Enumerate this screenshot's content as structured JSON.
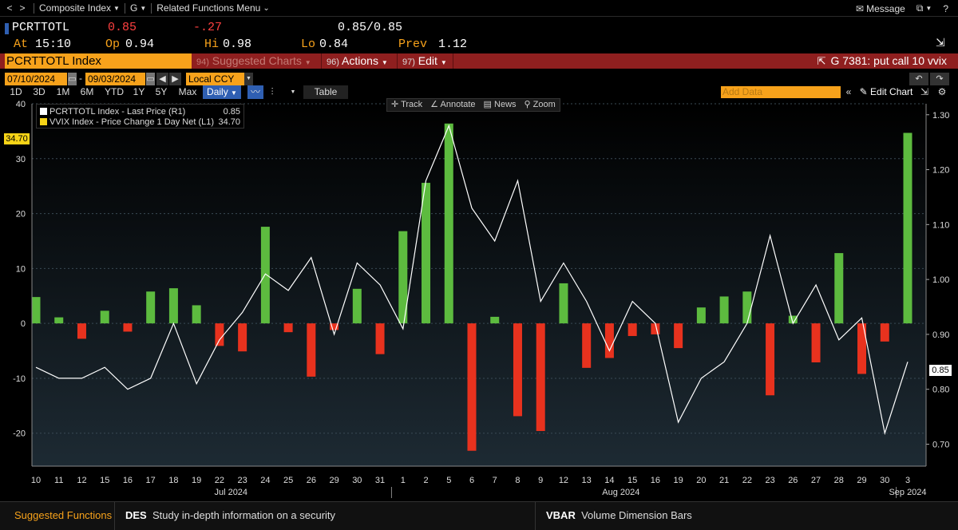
{
  "nav": {
    "back_glyph": "<",
    "forward_glyph": ">",
    "composite": "Composite Index",
    "g": "G",
    "related": "Related Functions Menu",
    "message": "Message"
  },
  "quote": {
    "ticker": "PCRTTOTL",
    "last": "0.85",
    "change": "-.27",
    "bidask": "0.85/0.85",
    "at_label": "At",
    "at_time": "15:10",
    "op_label": "Op",
    "op": "0.94",
    "hi_label": "Hi",
    "hi": "0.98",
    "lo_label": "Lo",
    "lo": "0.84",
    "prev_label": "Prev",
    "prev": "1.12"
  },
  "secbar": {
    "name": "PCRTTOTL Index",
    "suggested_num": "94)",
    "suggested": "Suggested Charts",
    "actions_num": "96)",
    "actions": "Actions",
    "edit_num": "97)",
    "edit": "Edit",
    "title": "G 7381: put call 10 vvix"
  },
  "datebar": {
    "start": "07/10/2024",
    "dash": "-",
    "end": "09/03/2024",
    "currency": "Local CCY"
  },
  "rangebar": {
    "ranges": [
      "1D",
      "3D",
      "1M",
      "6M",
      "YTD",
      "1Y",
      "5Y",
      "Max"
    ],
    "period": "Daily",
    "table": "Table",
    "add_data_placeholder": "Add Data",
    "edit_chart": "Edit Chart"
  },
  "tools": [
    "Track",
    "Annotate",
    "News",
    "Zoom"
  ],
  "legend": [
    {
      "label": "PCRTTOTL Index - Last Price (R1)",
      "value": "0.85",
      "color": "#ffffff"
    },
    {
      "label": "VVIX Index - Price Change 1 Day Net (L1)",
      "value": "34.70",
      "color": "#f7d417"
    }
  ],
  "flags": {
    "left": "34.70",
    "right": "0.85"
  },
  "colors": {
    "up": "#5dbb3f",
    "down": "#e8321e",
    "line": "#ffffff",
    "accent": "#f7a21b",
    "bar_bg": "#8f1f1f"
  },
  "chart_data": {
    "type": "bar+line",
    "left_axis": {
      "ticks": [
        "-20",
        "-10",
        "0",
        "10",
        "20",
        "30",
        "40"
      ],
      "ylim": [
        -26,
        40
      ]
    },
    "right_axis": {
      "ticks": [
        "0.70",
        "0.80",
        "0.90",
        "1.00",
        "1.10",
        "1.20",
        "1.30"
      ],
      "ylim": [
        0.66,
        1.32
      ]
    },
    "x_labels": [
      "10",
      "11",
      "12",
      "15",
      "16",
      "17",
      "18",
      "19",
      "22",
      "23",
      "24",
      "25",
      "26",
      "29",
      "30",
      "31",
      "1",
      "2",
      "5",
      "6",
      "7",
      "8",
      "9",
      "12",
      "13",
      "14",
      "15",
      "16",
      "19",
      "20",
      "21",
      "22",
      "23",
      "26",
      "27",
      "28",
      "29",
      "30",
      "3"
    ],
    "month_labels": [
      {
        "text": "Jul 2024",
        "index": 8.5
      },
      {
        "text": "Aug 2024",
        "index": 25.5
      },
      {
        "text": "Sep 2024",
        "index": 38
      }
    ],
    "series": [
      {
        "name": "VVIX Index - Price Change 1 Day Net (L1)",
        "axis": "left",
        "values": [
          4.8,
          1.1,
          -2.8,
          2.3,
          -1.5,
          5.8,
          6.4,
          3.3,
          -4.1,
          -5.1,
          17.6,
          -1.6,
          -9.7,
          -1.2,
          6.3,
          -5.6,
          16.8,
          25.6,
          36.4,
          -23.2,
          1.2,
          -16.9,
          -19.6,
          7.3,
          -8.1,
          -6.3,
          -2.3,
          -2.0,
          -4.5,
          2.9,
          4.9,
          5.8,
          -13.1,
          1.4,
          -7.1,
          12.8,
          -9.2,
          -3.3,
          34.7
        ]
      },
      {
        "name": "PCRTTOTL Index - Last Price (R1)",
        "axis": "right",
        "values": [
          0.84,
          0.82,
          0.82,
          0.84,
          0.8,
          0.82,
          0.92,
          0.81,
          0.89,
          0.94,
          1.01,
          0.98,
          1.04,
          0.9,
          1.03,
          0.99,
          0.91,
          1.18,
          1.28,
          1.13,
          1.07,
          1.18,
          0.96,
          1.03,
          0.96,
          0.87,
          0.96,
          0.92,
          0.74,
          0.82,
          0.85,
          0.92,
          1.08,
          0.92,
          0.99,
          0.89,
          0.93,
          0.72,
          0.85
        ]
      }
    ]
  }
}
